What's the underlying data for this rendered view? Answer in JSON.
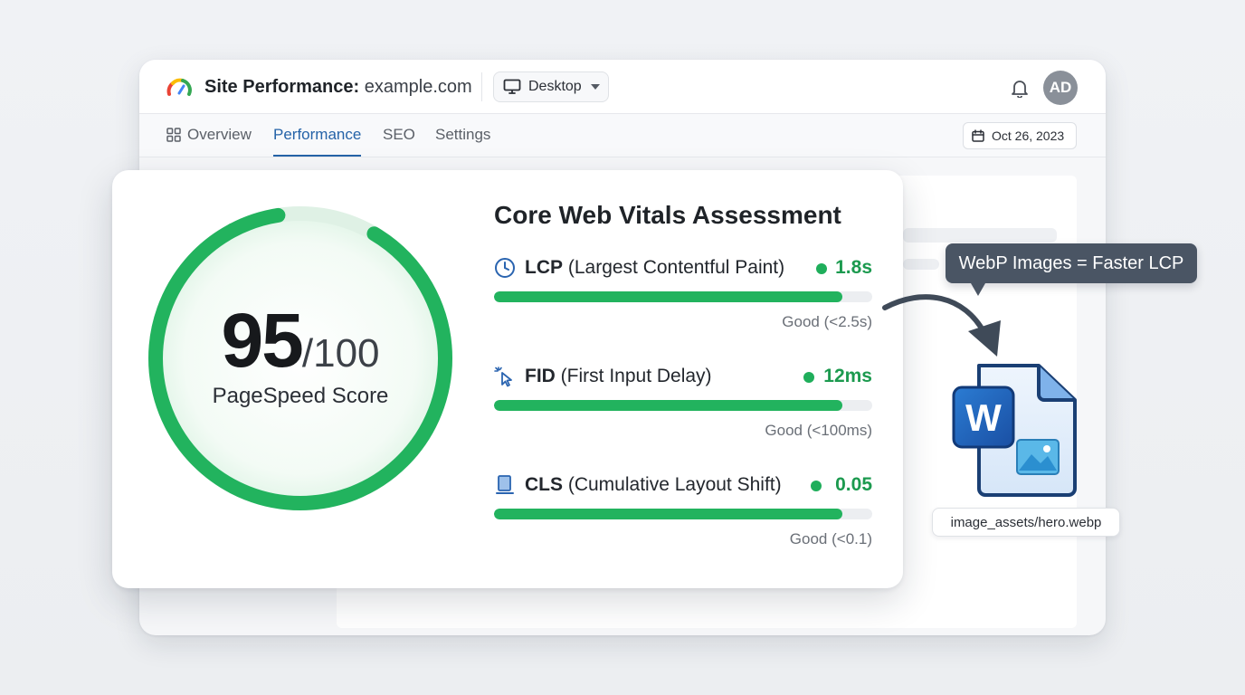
{
  "header": {
    "title_bold": "Site Performance:",
    "title_site": "example.com",
    "device_select": "Desktop",
    "avatar_initials": "AD"
  },
  "tabs": [
    {
      "label": "Overview",
      "active": false
    },
    {
      "label": "Performance",
      "active": true
    },
    {
      "label": "SEO",
      "active": false
    },
    {
      "label": "Settings",
      "active": false
    }
  ],
  "date": "Oct 26, 2023",
  "score": {
    "value": "95",
    "max": "/100",
    "label": "PageSpeed Score",
    "fraction": 0.95,
    "color": "#22b35e"
  },
  "cwv": {
    "title": "Core Web Vitals Assessment",
    "metrics": [
      {
        "abbr": "LCP",
        "name": "(Largest Contentful Paint)",
        "value": "1.8s",
        "status": "Good (<2.5s)",
        "fill": 0.92,
        "icon": "clock-icon"
      },
      {
        "abbr": "FID",
        "name": "(First Input Delay)",
        "value": "12ms",
        "status": "Good (<100ms)",
        "fill": 0.92,
        "icon": "cursor-click-icon"
      },
      {
        "abbr": "CLS",
        "name": "(Cumulative Layout Shift)",
        "value": "0.05",
        "status": "Good (<0.1)",
        "fill": 0.92,
        "icon": "layout-shift-icon"
      }
    ]
  },
  "tooltip": "WebP Images = Faster LCP",
  "file": {
    "name": "image_assets/hero.webp",
    "icon": "word-image-file-icon"
  },
  "colors": {
    "good": "#1c9a4f",
    "accent": "#2563a8",
    "tooltip": "#4a5564"
  }
}
